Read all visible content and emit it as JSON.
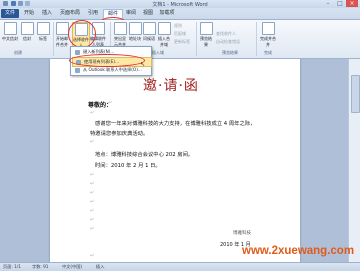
{
  "window": {
    "title": "文档1 - Microsoft Word"
  },
  "tabs": [
    "文件",
    "开始",
    "插入",
    "页面布局",
    "引用",
    "邮件",
    "审阅",
    "视图",
    "加载项"
  ],
  "ribbon": {
    "buttons": [
      "中文信封",
      "信封",
      "标签",
      "开始邮件合并",
      "选择收件人",
      "编辑收件人列表",
      "突出显示合并域",
      "地址块",
      "问候语",
      "插入合并域",
      "规则",
      "匹配域",
      "更新标签",
      "预览结果",
      "查找收件人",
      "自动检查错误",
      "完成并合并"
    ],
    "groups": [
      "创建",
      "开始邮件合并",
      "编写和插入域",
      "预览结果",
      "完成"
    ]
  },
  "menu": {
    "items": [
      "键入新列表(N)...",
      "使用现有列表(E)...",
      "从 Outlook 联系人中选择(O)..."
    ]
  },
  "doc": {
    "title": "邀·请·函",
    "salutation": "尊敬的：",
    "line1": "感谢您一年来对博雅科技的大力支持，在博雅科技成立 4 周年之际，",
    "line2": "特邀请您参加庆典活动。",
    "line3": "地点：博雅科技综合会议中心 202 房间。",
    "line4": "时间：2010 年 2 月 1 日。",
    "signature": "博雅科技",
    "date": "2010 年 1 月",
    "para_mark": "↵"
  },
  "status": {
    "page": "页面: 1/1",
    "words": "字数: 91",
    "lang": "中文(中国)",
    "insert": "插入"
  },
  "watermark": {
    "url": "www.2xuewang.com"
  },
  "colors": {
    "title_red": "#a02020",
    "highlight": "#ffe8a6",
    "ring": "#e0302a",
    "watermark": "#e05a1c"
  }
}
